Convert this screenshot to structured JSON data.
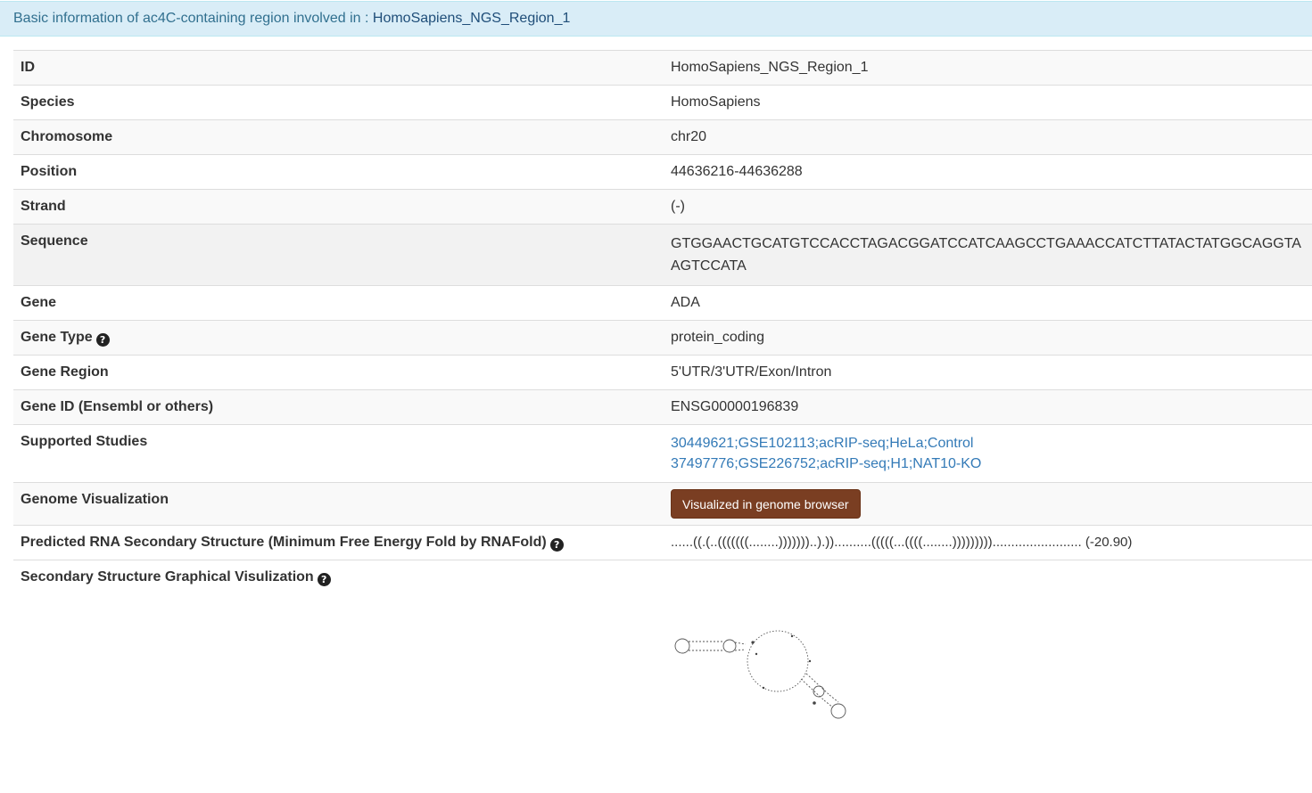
{
  "header": {
    "prefix": "Basic information of ac4C-containing region involved in : ",
    "region": "HomoSapiens_NGS_Region_1"
  },
  "rows": {
    "id": {
      "label": "ID",
      "value": "HomoSapiens_NGS_Region_1"
    },
    "species": {
      "label": "Species",
      "value": "HomoSapiens"
    },
    "chromosome": {
      "label": "Chromosome",
      "value": "chr20"
    },
    "position": {
      "label": "Position",
      "value": "44636216-44636288"
    },
    "strand": {
      "label": "Strand",
      "value": "(-)"
    },
    "sequence": {
      "label": "Sequence",
      "value": "GTGGAACTGCATGTCCACCTAGACGGATCCATCAAGCCTGAAACCATCTTATACTATGGCAGGTAAGTCCATA"
    },
    "gene": {
      "label": "Gene",
      "value": "ADA"
    },
    "gene_type": {
      "label": "Gene Type",
      "value": "protein_coding"
    },
    "gene_region": {
      "label": "Gene Region",
      "value": "5'UTR/3'UTR/Exon/Intron"
    },
    "gene_id": {
      "label": "Gene ID (Ensembl or others)",
      "value": "ENSG00000196839"
    },
    "studies": {
      "label": "Supported Studies",
      "items": [
        "30449621;GSE102113;acRIP-seq;HeLa;Control",
        "37497776;GSE226752;acRIP-seq;H1;NAT10-KO"
      ]
    },
    "genome_vis": {
      "label": "Genome Visualization",
      "button": "Visualized in genome browser"
    },
    "mfe": {
      "label": "Predicted RNA Secondary Structure (Minimum Free Energy Fold by RNAFold)",
      "value": "......((.(..(((((((........)))))))..).))..........(((((...((((........)))))))))........................ (-20.90)"
    },
    "graph": {
      "label": "Secondary Structure Graphical Visulization"
    }
  },
  "help_icon": "question-circle-icon",
  "colors": {
    "header_bg": "#d9edf7",
    "button_bg": "#7a3e22",
    "link": "#337ab7"
  }
}
